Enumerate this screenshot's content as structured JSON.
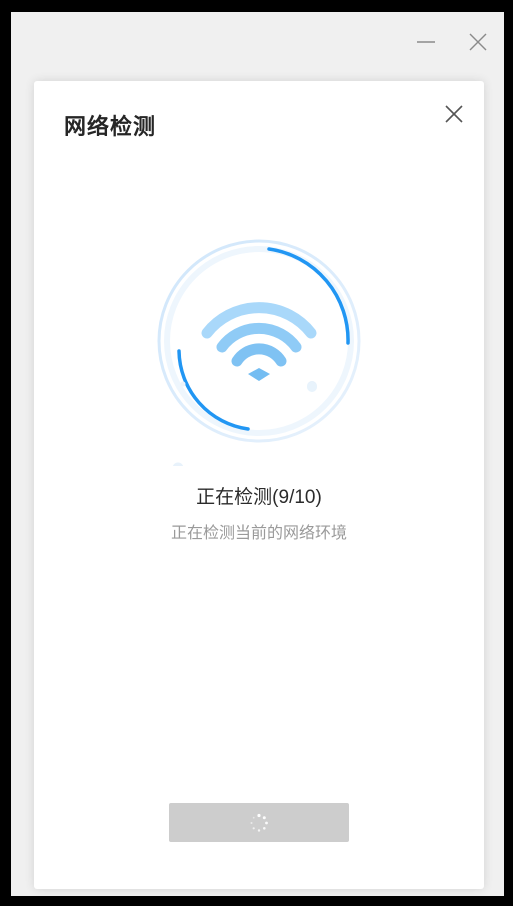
{
  "window": {
    "controls": {
      "minimize": "minimize-icon",
      "close": "close-icon"
    }
  },
  "dialog": {
    "title": "网络检测",
    "close_icon": "close-icon"
  },
  "status": {
    "title": "正在检测(9/10)",
    "subtitle": "正在检测当前的网络环境"
  },
  "action_button": {
    "icon": "loading-spinner-icon"
  },
  "colors": {
    "accent": "#2196f3",
    "wifi_light": "#8ccaf6",
    "button_disabled": "#cdcdcd",
    "title_text": "#262626",
    "sub_text": "#9a9a9a"
  }
}
